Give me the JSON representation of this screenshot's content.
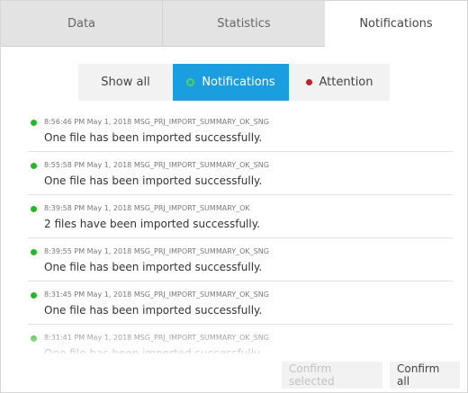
{
  "tabs": [
    {
      "label": "Data"
    },
    {
      "label": "Statistics"
    },
    {
      "label": "Notifications"
    }
  ],
  "filters": [
    {
      "label": "Show all"
    },
    {
      "label": "Notifications"
    },
    {
      "label": "Attention"
    }
  ],
  "colors": {
    "accent": "#1a9ee0",
    "success": "#2ab52a",
    "attention": "#c0202a"
  },
  "notifications": [
    {
      "meta": "8:56:46 PM May 1, 2018 MSG_PRJ_IMPORT_SUMMARY_OK_SNG",
      "message": "One file has been imported successfully."
    },
    {
      "meta": "8:55:58 PM May 1, 2018 MSG_PRJ_IMPORT_SUMMARY_OK_SNG",
      "message": "One file has been imported successfully."
    },
    {
      "meta": "8:39:58 PM May 1, 2018 MSG_PRJ_IMPORT_SUMMARY_OK",
      "message": "2 files have been imported successfully."
    },
    {
      "meta": "8:39:55 PM May 1, 2018 MSG_PRJ_IMPORT_SUMMARY_OK_SNG",
      "message": "One file has been imported successfully."
    },
    {
      "meta": "8:31:45 PM May 1, 2018 MSG_PRJ_IMPORT_SUMMARY_OK_SNG",
      "message": "One file has been imported successfully."
    },
    {
      "meta": "8:31:41 PM May 1, 2018 MSG_PRJ_IMPORT_SUMMARY_OK_SNG",
      "message": "One file has been imported successfully."
    }
  ],
  "buttons": {
    "confirm_selected": "Confirm selected",
    "confirm_all": "Confirm all"
  }
}
